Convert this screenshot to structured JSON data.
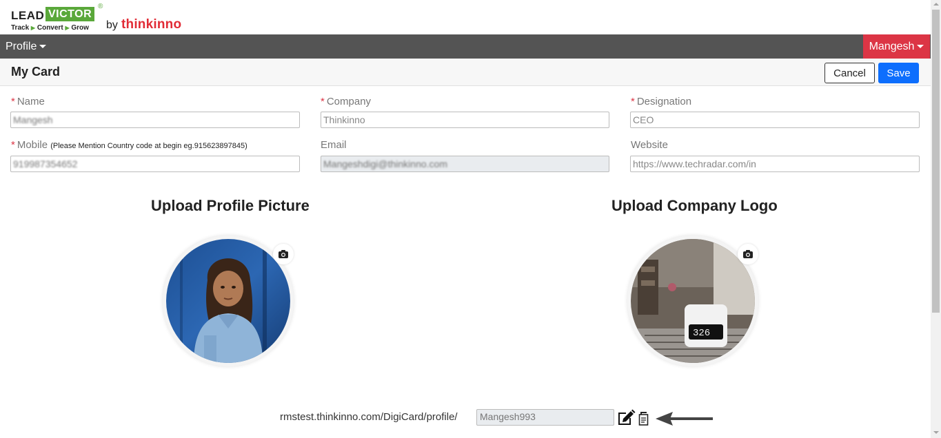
{
  "brand": {
    "logo_lead": "LEAD",
    "logo_victor": "VICTOR",
    "logo_reg": "®",
    "logo_tag_1": "Track",
    "logo_tag_2": "Convert",
    "logo_tag_3": "Grow",
    "by": "by",
    "company": "thinkinno"
  },
  "nav": {
    "profile_label": "Profile",
    "user_label": "Mangesh"
  },
  "header": {
    "title": "My Card",
    "cancel_label": "Cancel",
    "save_label": "Save"
  },
  "form": {
    "name": {
      "label": "Name",
      "required": "*",
      "value": "Mangesh"
    },
    "company": {
      "label": "Company",
      "required": "*",
      "value": "Thinkinno"
    },
    "designation": {
      "label": "Designation",
      "required": "*",
      "value": "CEO"
    },
    "mobile": {
      "label": "Mobile",
      "required": "*",
      "hint": "(Please Mention Country code at begin eg.915623897845)",
      "value": "919987354652"
    },
    "email": {
      "label": "Email",
      "value": "Mangeshdigi@thinkinno.com"
    },
    "website": {
      "label": "Website",
      "value": "https://www.techradar.com/in"
    }
  },
  "uploads": {
    "profile_title": "Upload Profile Picture",
    "logo_title": "Upload Company Logo",
    "camera_icon": "camera-icon"
  },
  "profile_url": {
    "prefix": "rmstest.thinkinno.com/DigiCard/profile/",
    "slug": "Mangesh993",
    "edit_icon": "edit-icon",
    "copy_icon": "copy-icon"
  },
  "colors": {
    "nav_bg": "#545454",
    "user_btn": "#dc3545",
    "save_btn": "#0d6efd",
    "brand_green": "#5aa83a",
    "brand_red": "#e12b35"
  }
}
